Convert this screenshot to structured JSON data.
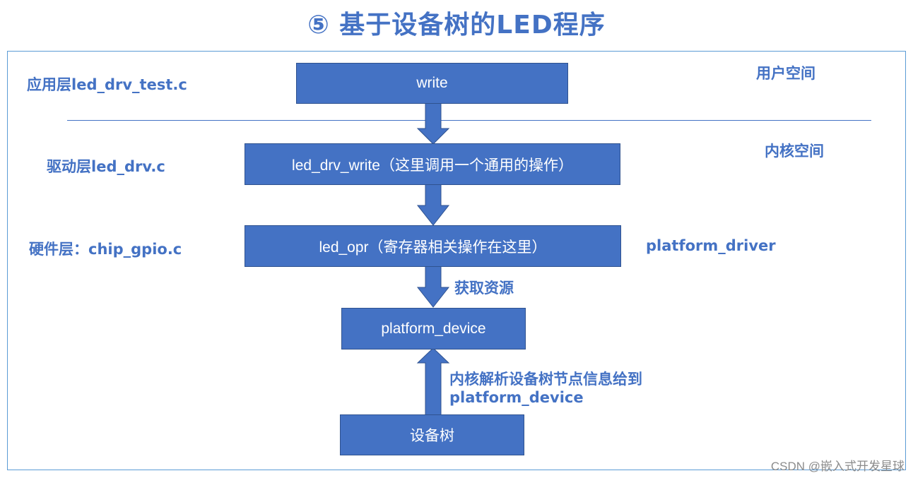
{
  "title": "⑤ 基于设备树的LED程序",
  "layers": {
    "app": "应用层led_drv_test.c",
    "driver": "驱动层led_drv.c",
    "hardware": "硬件层：chip_gpio.c"
  },
  "spaces": {
    "user": "用户空间",
    "kernel": "内核空间"
  },
  "boxes": {
    "write": "write",
    "led_drv_write": "led_drv_write（这里调用一个通用的操作）",
    "led_opr": "led_opr（寄存器相关操作在这里）",
    "platform_device": "platform_device",
    "device_tree": "设备树"
  },
  "annotations": {
    "platform_driver": "platform_driver",
    "get_resources": "获取资源",
    "parse_line1": "内核解析设备树节点信息给到",
    "parse_line2": "platform_device"
  },
  "colors": {
    "accent": "#4472c4",
    "frame": "#5b9bd5",
    "box_border": "#2f528f"
  },
  "watermark": "CSDN @嵌入式开发星球"
}
